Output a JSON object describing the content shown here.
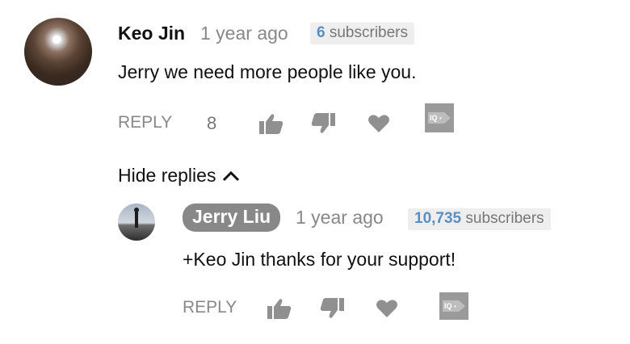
{
  "comment": {
    "author": "Keo Jin",
    "time": "1 year ago",
    "subscribers_count": "6",
    "subscribers_label": "subscribers",
    "text": "Jerry we need more people like you.",
    "reply_label": "REPLY",
    "like_count": "8",
    "icons": [
      "avatar",
      "thumbs-up-icon",
      "thumbs-down-icon",
      "heart-icon",
      "iq-flag-icon"
    ]
  },
  "replies_toggle": {
    "label": "Hide replies",
    "icon": "chevron-up-icon"
  },
  "reply": {
    "author": "Jerry Liu",
    "time": "1 year ago",
    "subscribers_count": "10,735",
    "subscribers_label": "subscribers",
    "text": "+Keo Jin thanks for your support!",
    "reply_label": "REPLY",
    "icons": [
      "avatar",
      "thumbs-up-icon",
      "thumbs-down-icon",
      "heart-icon",
      "iq-flag-icon"
    ]
  },
  "colors": {
    "muted": "#888888",
    "subscriber_number": "#5a8fc4",
    "badge_background": "#eeeeee",
    "author_pill": "#888888"
  }
}
